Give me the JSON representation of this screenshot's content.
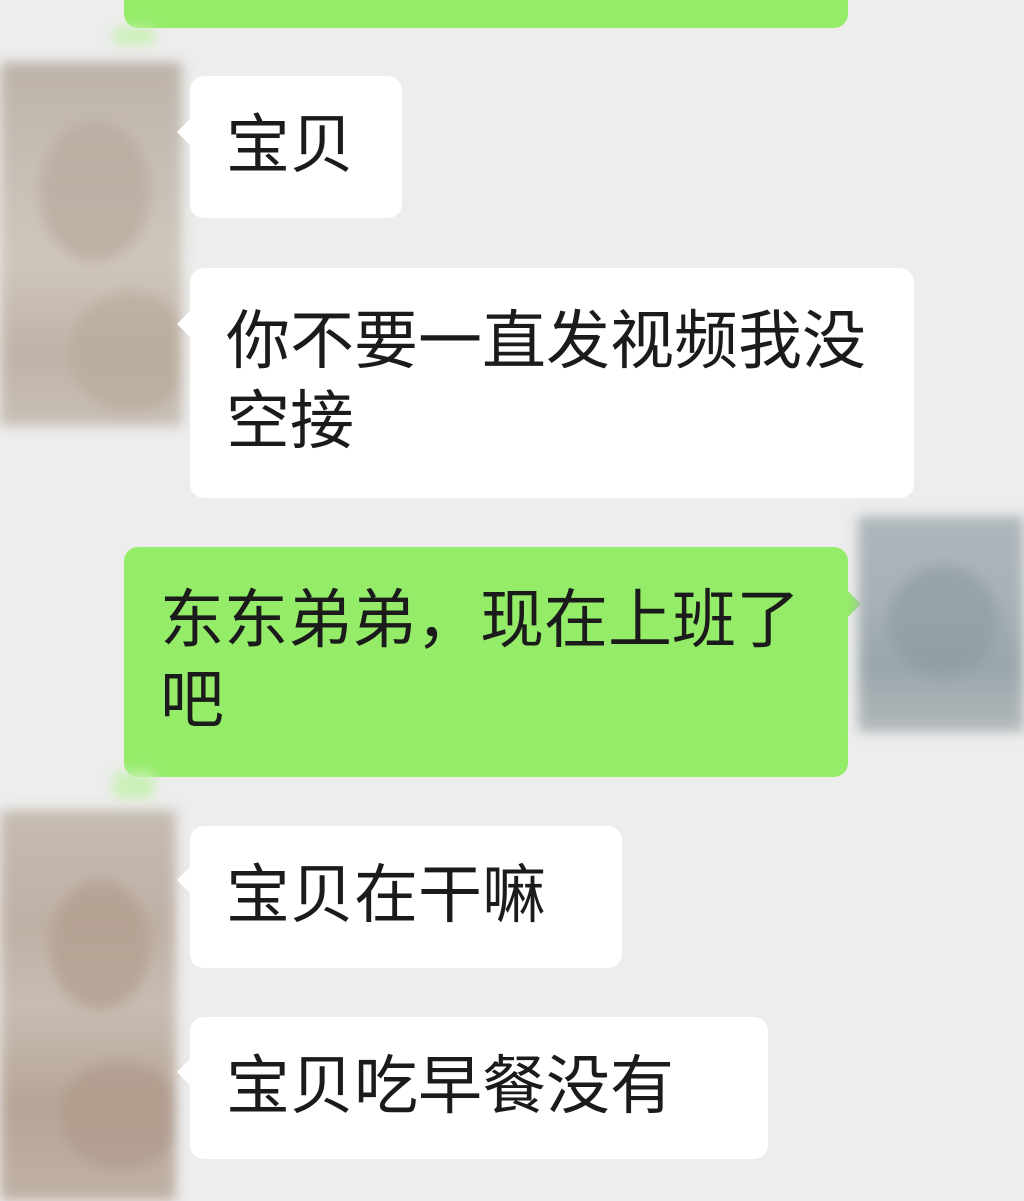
{
  "chat": {
    "messages": [
      {
        "from": "contact",
        "text": "宝贝"
      },
      {
        "from": "contact",
        "text": "你不要一直发视频我没空接"
      },
      {
        "from": "me",
        "text": "东东弟弟，现在上班了吧"
      },
      {
        "from": "contact",
        "text": "宝贝在干嘛"
      },
      {
        "from": "contact",
        "text": "宝贝吃早餐没有"
      }
    ]
  },
  "colors": {
    "background": "#ededed",
    "incoming_bubble": "#ffffff",
    "outgoing_bubble": "#95ec69"
  },
  "icons": {
    "contact_avatar": "blurred-avatar",
    "self_avatar": "blurred-avatar"
  }
}
